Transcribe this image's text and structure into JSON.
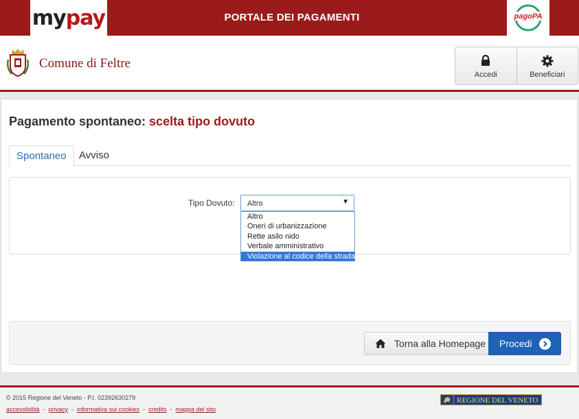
{
  "topbar": {
    "logo": {
      "my": "my",
      "pay": "pay"
    },
    "portal_title": "PORTALE DEI PAGAMENTI",
    "pagopa_logo": "pagoPA"
  },
  "header": {
    "comune_name": "Comune di Feltre",
    "buttons": [
      {
        "label": "Accedi",
        "icon": "lock-icon"
      },
      {
        "label": "Beneficiari",
        "icon": "gear-icon"
      }
    ]
  },
  "main": {
    "title_prefix": "Pagamento spontaneo:",
    "title_accent": "scelta tipo dovuto",
    "tabs": [
      {
        "label": "Spontaneo",
        "active": true
      },
      {
        "label": "Avviso",
        "active": false
      }
    ],
    "form": {
      "label": "Tipo Dovuto:",
      "selected": "Altro",
      "options": [
        "Altro",
        "Oneri di urbanizzazione",
        "Rette asilo nido",
        "Verbale amministrativo",
        "Violazione al codice della strada"
      ],
      "highlighted_option": "Violazione al codice della strada"
    },
    "actions": {
      "home_label": "Torna alla Homepage",
      "proceed_label": "Procedi"
    }
  },
  "footer": {
    "copyright": "© 2015 Regione del Veneto - P.I. 02392630279",
    "links": [
      "accessibilità",
      "privacy",
      "informativa sui cookies",
      "credits",
      "mappa del sito"
    ],
    "region_logo": "REGIONE DEL VENETO"
  },
  "colors": {
    "brand_red": "#9b1b1b",
    "primary_blue": "#1f63b6",
    "tab_blue": "#2a6fb0"
  }
}
